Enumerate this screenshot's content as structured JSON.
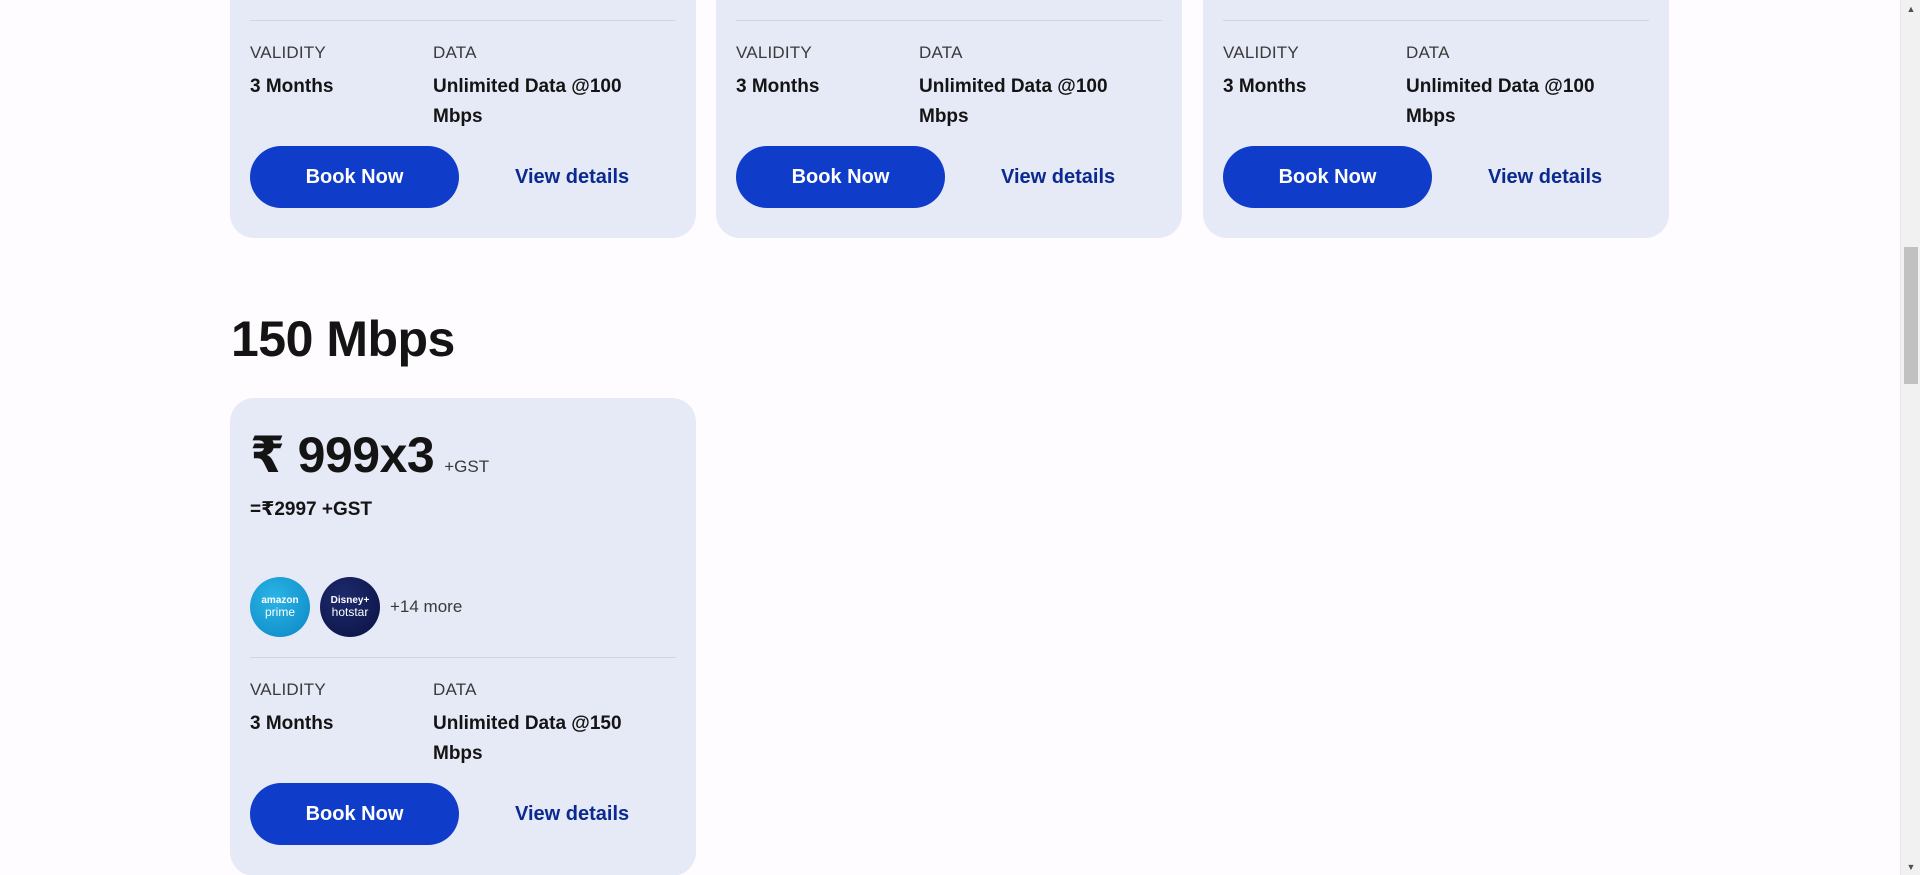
{
  "top_cards": [
    {
      "validity_label": "VALIDITY",
      "validity_value": "3 Months",
      "data_label": "DATA",
      "data_value_line1": "Unlimited Data @100",
      "data_value_line2": "Mbps",
      "book_label": "Book Now",
      "details_label": "View details"
    },
    {
      "validity_label": "VALIDITY",
      "validity_value": "3 Months",
      "data_label": "DATA",
      "data_value_line1": "Unlimited Data @100",
      "data_value_line2": "Mbps",
      "book_label": "Book Now",
      "details_label": "View details"
    },
    {
      "validity_label": "VALIDITY",
      "validity_value": "3 Months",
      "data_label": "DATA",
      "data_value_line1": "Unlimited Data @100",
      "data_value_line2": "Mbps",
      "book_label": "Book Now",
      "details_label": "View details"
    }
  ],
  "section": {
    "title": "150 Mbps"
  },
  "plan": {
    "price": "₹ 999x3",
    "gst_tag": "+GST",
    "total": "=₹2997 +GST",
    "ott": [
      {
        "icon": "amazon-prime-icon",
        "line1": "amazon",
        "line2": "prime"
      },
      {
        "icon": "disney-hotstar-icon",
        "line1": "Disney+",
        "line2": "hotstar"
      }
    ],
    "more_label": "+14 more",
    "validity_label": "VALIDITY",
    "validity_value": "3 Months",
    "data_label": "DATA",
    "data_value_line1": "Unlimited Data @150",
    "data_value_line2": "Mbps",
    "book_label": "Book Now",
    "details_label": "View details"
  },
  "colors": {
    "card_bg": "#e6e9f6",
    "primary_button": "#0f3cc9",
    "link": "#0b2a8f",
    "page_bg": "#fefcfe"
  }
}
